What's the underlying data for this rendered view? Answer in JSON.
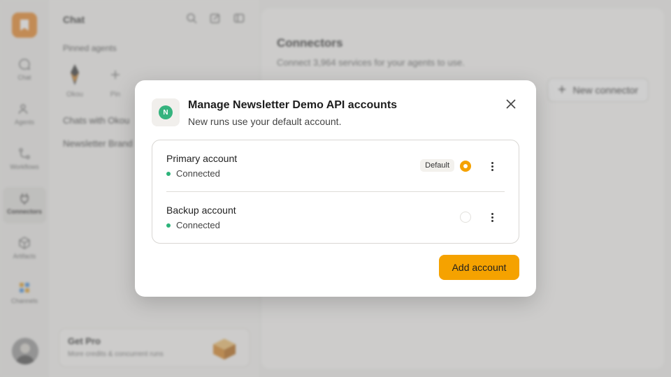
{
  "rail": {
    "items": [
      {
        "label": "Chat",
        "icon": "chat-bubble-icon"
      },
      {
        "label": "Agents",
        "icon": "people-icon"
      },
      {
        "label": "Workflows",
        "icon": "workflow-icon"
      },
      {
        "label": "Connectors",
        "icon": "plug-icon"
      },
      {
        "label": "Artifacts",
        "icon": "cube-icon"
      },
      {
        "label": "Channels",
        "icon": "channels-icon"
      }
    ],
    "active": "Connectors"
  },
  "panel": {
    "title": "Chat",
    "pinned_label": "Pinned agents",
    "agents": [
      {
        "name": "Okou",
        "icon": "agent-avatar-icon"
      },
      {
        "name": "Pin",
        "icon": "plus-icon"
      }
    ],
    "chats": [
      "Chats with Okou",
      "Newsletter Brand"
    ],
    "getpro": {
      "title": "Get Pro",
      "subtitle": "More credits & concurrent runs"
    }
  },
  "main": {
    "title": "Connectors",
    "subtitle": "Connect 3,964 services for your agents to use.",
    "new_connector_label": "New connector"
  },
  "modal": {
    "logo_letter": "N",
    "title": "Manage Newsletter Demo API accounts",
    "subtitle": "New runs use your default account.",
    "accounts": [
      {
        "name": "Primary account",
        "status": "Connected",
        "badge": "Default",
        "selected": true
      },
      {
        "name": "Backup account",
        "status": "Connected",
        "badge": "",
        "selected": false
      }
    ],
    "add_button_label": "Add account",
    "colors": {
      "accent": "#f5a200",
      "status_green": "#2db37a",
      "logo_green": "#35b37e"
    }
  }
}
